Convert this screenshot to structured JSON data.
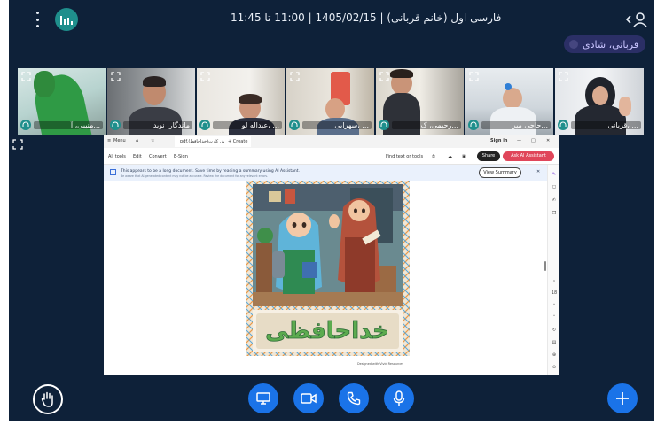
{
  "header": {
    "title": "فارسی اول (خانم قربانی) | 1405/02/15 | 11:00 تا 11:45",
    "menu_icon": "more-vertical-icon",
    "logo_icon": "audio-bars-icon",
    "user_icon": "user-chevron-icon"
  },
  "speaker_pill": {
    "label": "قربانی، شادی"
  },
  "participants": [
    {
      "name": "منیبی، آ...",
      "icon": "headphones-icon"
    },
    {
      "name": "ماندگار، نوید",
      "icon": "headphones-icon"
    },
    {
      "name": "عبداله لو، ...",
      "icon": "headphones-icon"
    },
    {
      "name": "سهرابی، ...",
      "icon": "headphones-icon"
    },
    {
      "name": "رحیمی، ک...",
      "icon": "headphones-icon"
    },
    {
      "name": "حاجی میر...",
      "icon": "headphones-icon"
    },
    {
      "name": "قربانی، ...",
      "icon": "headphones-icon"
    }
  ],
  "shared_screen": {
    "tab_label": "pdf.فلش کارت(خداحافظ)",
    "new_tab": "+ Create",
    "menu": "Menu",
    "sign_in": "Sign in",
    "toolbar": [
      "All tools",
      "Edit",
      "Convert",
      "E-Sign"
    ],
    "find": "Find text or tools",
    "share": "Share",
    "ai_assistant": "Ask AI Assistant",
    "notice": "This appears to be a long document. Save time by reading a summary using AI Assistant.",
    "notice_small": "Be aware that AI-generated content may not be accurate. Review the document for any relevant errors.",
    "view_summary": "View Summary",
    "page_number": "18",
    "doc_word": "خداحافظی",
    "doc_footer": "Designed with Vivid Resources"
  },
  "controls": {
    "raise_hand": "raise-hand-icon",
    "screen": "monitor-icon",
    "camera": "video-camera-icon",
    "phone": "phone-icon",
    "mic": "microphone-icon",
    "add": "plus-icon",
    "accent": "#1a73e8",
    "background": "#0e2139"
  }
}
